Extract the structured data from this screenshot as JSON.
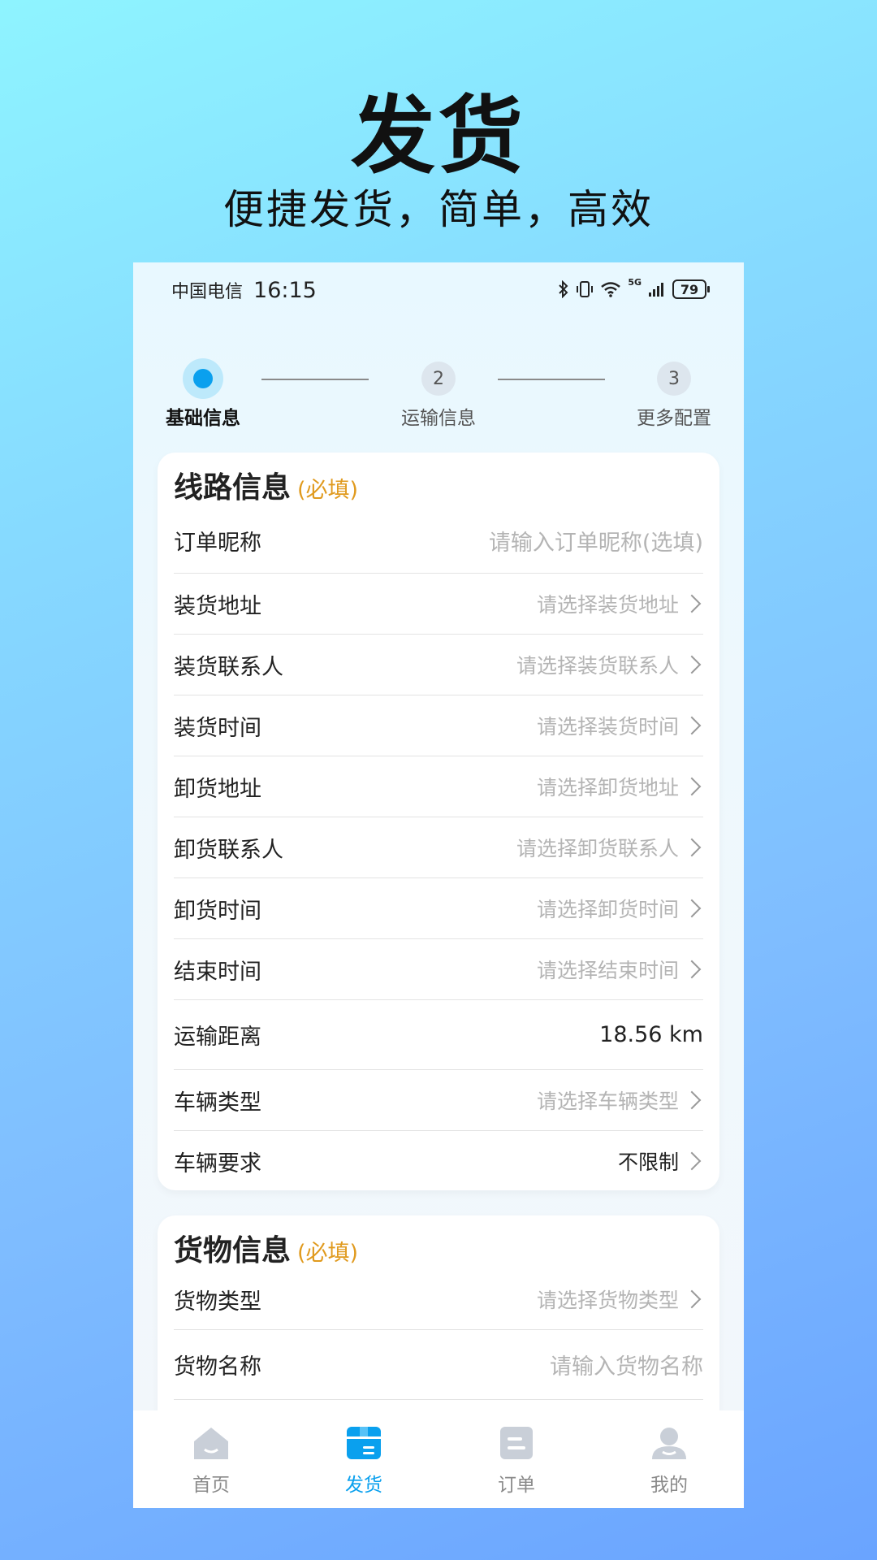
{
  "promo": {
    "title": "发货",
    "subtitle": "便捷发货，简单，高效"
  },
  "status": {
    "carrier": "中国电信",
    "time": "16:15",
    "network": "5G",
    "battery": "79"
  },
  "stepper": {
    "steps": [
      {
        "num": "1",
        "label": "基础信息",
        "active": true
      },
      {
        "num": "2",
        "label": "运输信息"
      },
      {
        "num": "3",
        "label": "更多配置"
      }
    ]
  },
  "route_card": {
    "title": "线路信息",
    "required": "(必填)",
    "rows": [
      {
        "label": "订单昵称",
        "value": "请输入订单昵称(选填)"
      },
      {
        "label": "装货地址",
        "value": "请选择装货地址"
      },
      {
        "label": "装货联系人",
        "value": "请选择装货联系人"
      },
      {
        "label": "装货时间",
        "value": "请选择装货时间"
      },
      {
        "label": "卸货地址",
        "value": "请选择卸货地址"
      },
      {
        "label": "卸货联系人",
        "value": "请选择卸货联系人"
      },
      {
        "label": "卸货时间",
        "value": "请选择卸货时间"
      },
      {
        "label": "结束时间",
        "value": "请选择结束时间"
      },
      {
        "label": "运输距离",
        "value": "18.56 km"
      },
      {
        "label": "车辆类型",
        "value": "请选择车辆类型"
      },
      {
        "label": "车辆要求",
        "value": "不限制"
      }
    ]
  },
  "goods_card": {
    "title": "货物信息",
    "required": "(必填)",
    "rows": [
      {
        "label": "货物类型",
        "value": "请选择货物类型"
      },
      {
        "label": "货物名称",
        "value": "请输入货物名称"
      }
    ]
  },
  "tabbar": {
    "tabs": [
      {
        "label": "首页",
        "icon": "home-icon"
      },
      {
        "label": "发货",
        "icon": "box-icon",
        "active": true
      },
      {
        "label": "订单",
        "icon": "order-icon"
      },
      {
        "label": "我的",
        "icon": "user-icon"
      }
    ]
  },
  "colors": {
    "accent": "#0aa0ee",
    "required": "#e09a1e",
    "placeholder": "#b4b4b4"
  }
}
